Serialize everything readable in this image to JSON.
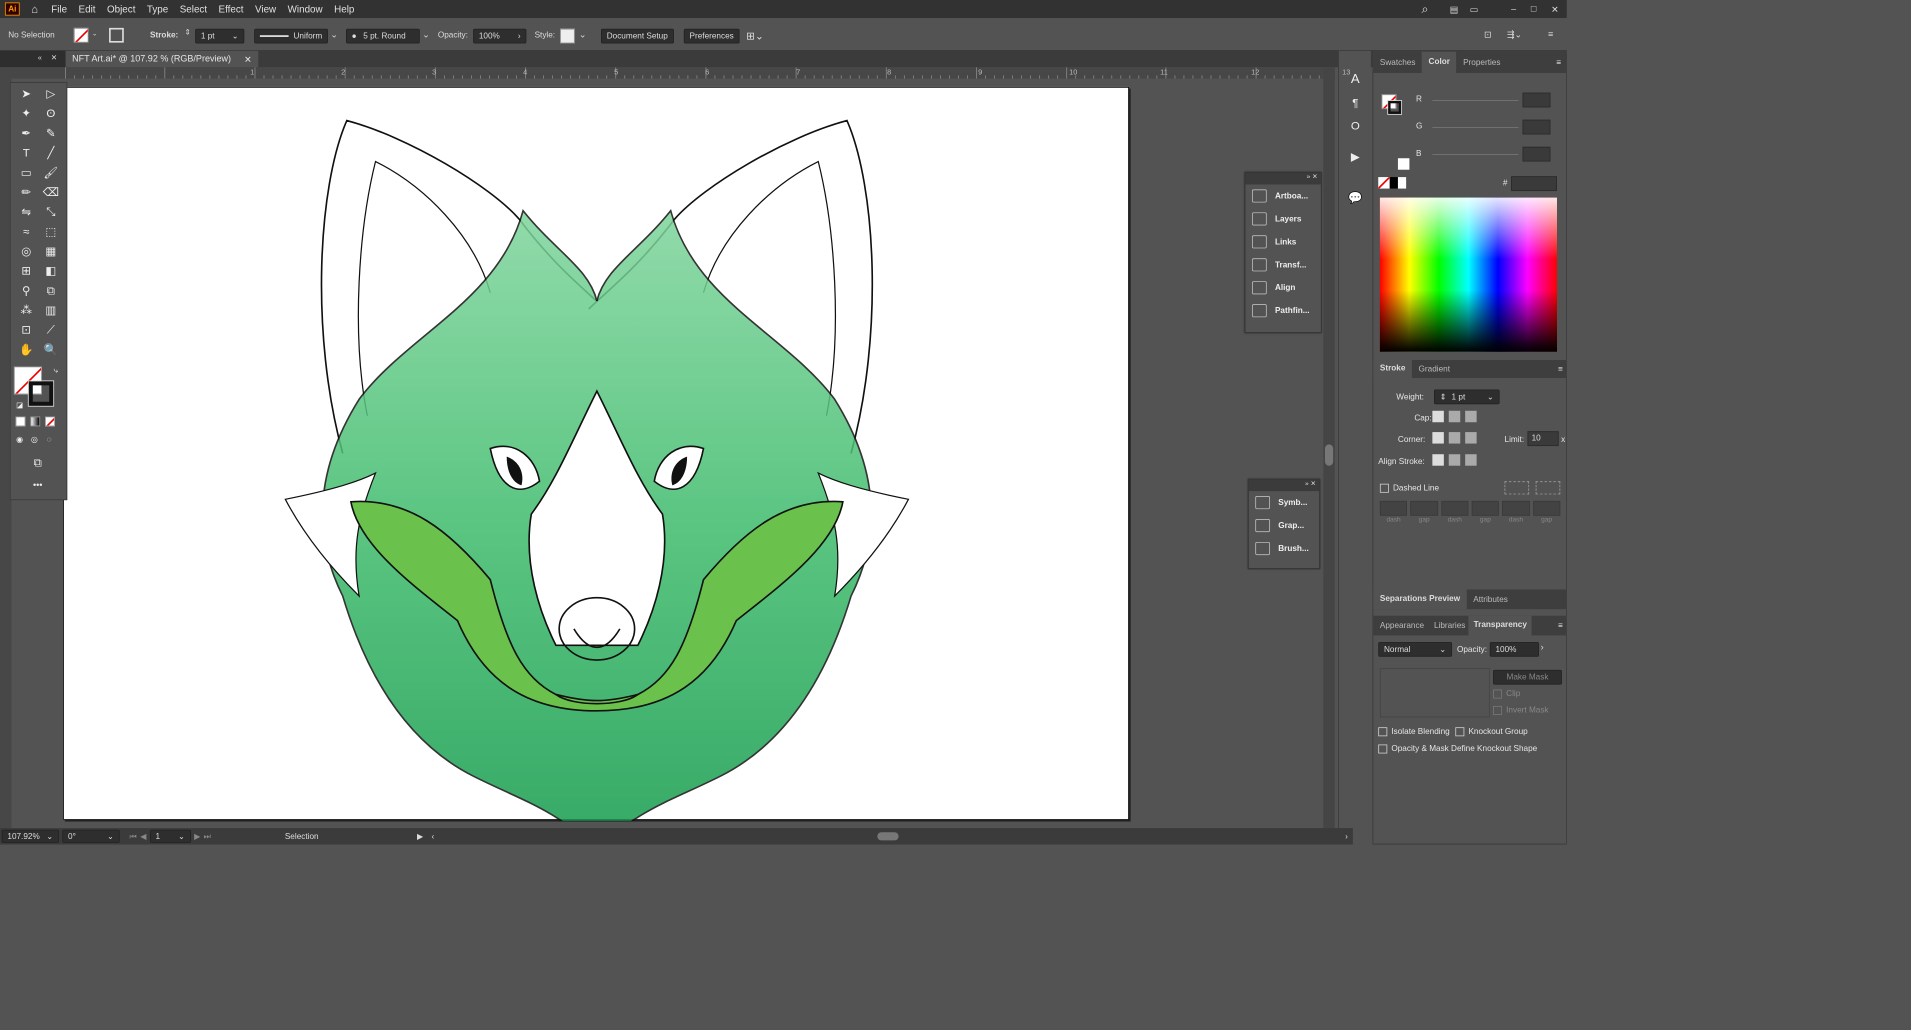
{
  "menu": {
    "items": [
      "File",
      "Edit",
      "Object",
      "Type",
      "Select",
      "Effect",
      "View",
      "Window",
      "Help"
    ]
  },
  "control": {
    "selection": "No Selection",
    "stroke_label": "Stroke:",
    "stroke_value": "1 pt",
    "profile": "Uniform",
    "brush": "5 pt. Round",
    "opacity_label": "Opacity:",
    "opacity_value": "100%",
    "style_label": "Style:",
    "doc_setup": "Document Setup",
    "preferences": "Preferences"
  },
  "document": {
    "tab": "NFT Art.ai* @ 107.92 % (RGB/Preview)",
    "ruler_ticks": [
      "1",
      "2",
      "3",
      "4",
      "5",
      "6",
      "7",
      "8",
      "9",
      "10",
      "11",
      "12",
      "13"
    ]
  },
  "float_panel_1": [
    "Artboa...",
    "Layers",
    "Links",
    "Transf...",
    "Align",
    "Pathfin..."
  ],
  "float_panel_2": [
    "Symb...",
    "Grap...",
    "Brush..."
  ],
  "color_panel": {
    "tabs": [
      "Swatches",
      "Color",
      "Properties"
    ],
    "channels": [
      "R",
      "G",
      "B"
    ],
    "hex_label": "#"
  },
  "stroke_panel": {
    "tabs": [
      "Stroke",
      "Gradient"
    ],
    "weight_label": "Weight:",
    "weight_value": "1 pt",
    "cap_label": "Cap:",
    "corner_label": "Corner:",
    "limit_label": "Limit:",
    "limit_value": "10",
    "x_label": "x",
    "align_label": "Align Stroke:",
    "dashed_label": "Dashed Line",
    "dash_labels": [
      "dash",
      "gap",
      "dash",
      "gap",
      "dash",
      "gap"
    ]
  },
  "sep_panel": {
    "tabs": [
      "Separations Preview",
      "Attributes"
    ]
  },
  "transparency_panel": {
    "tabs": [
      "Appearance",
      "Libraries",
      "Transparency"
    ],
    "mode": "Normal",
    "opacity_label": "Opacity:",
    "opacity_value": "100%",
    "make_mask": "Make Mask",
    "clip": "Clip",
    "invert": "Invert Mask",
    "isolate": "Isolate Blending",
    "knockout": "Knockout Group",
    "define": "Opacity & Mask Define Knockout Shape"
  },
  "status": {
    "zoom": "107.92%",
    "rotate": "0°",
    "artboard": "1",
    "tool": "Selection"
  },
  "colors": {
    "app_bg": "#535353",
    "dark": "#323232",
    "artboard": "#ffffff",
    "fox_light_green": "#3dbb6b",
    "fox_dark_green": "#129a4b",
    "muzzle_green": "#6ac24c"
  }
}
